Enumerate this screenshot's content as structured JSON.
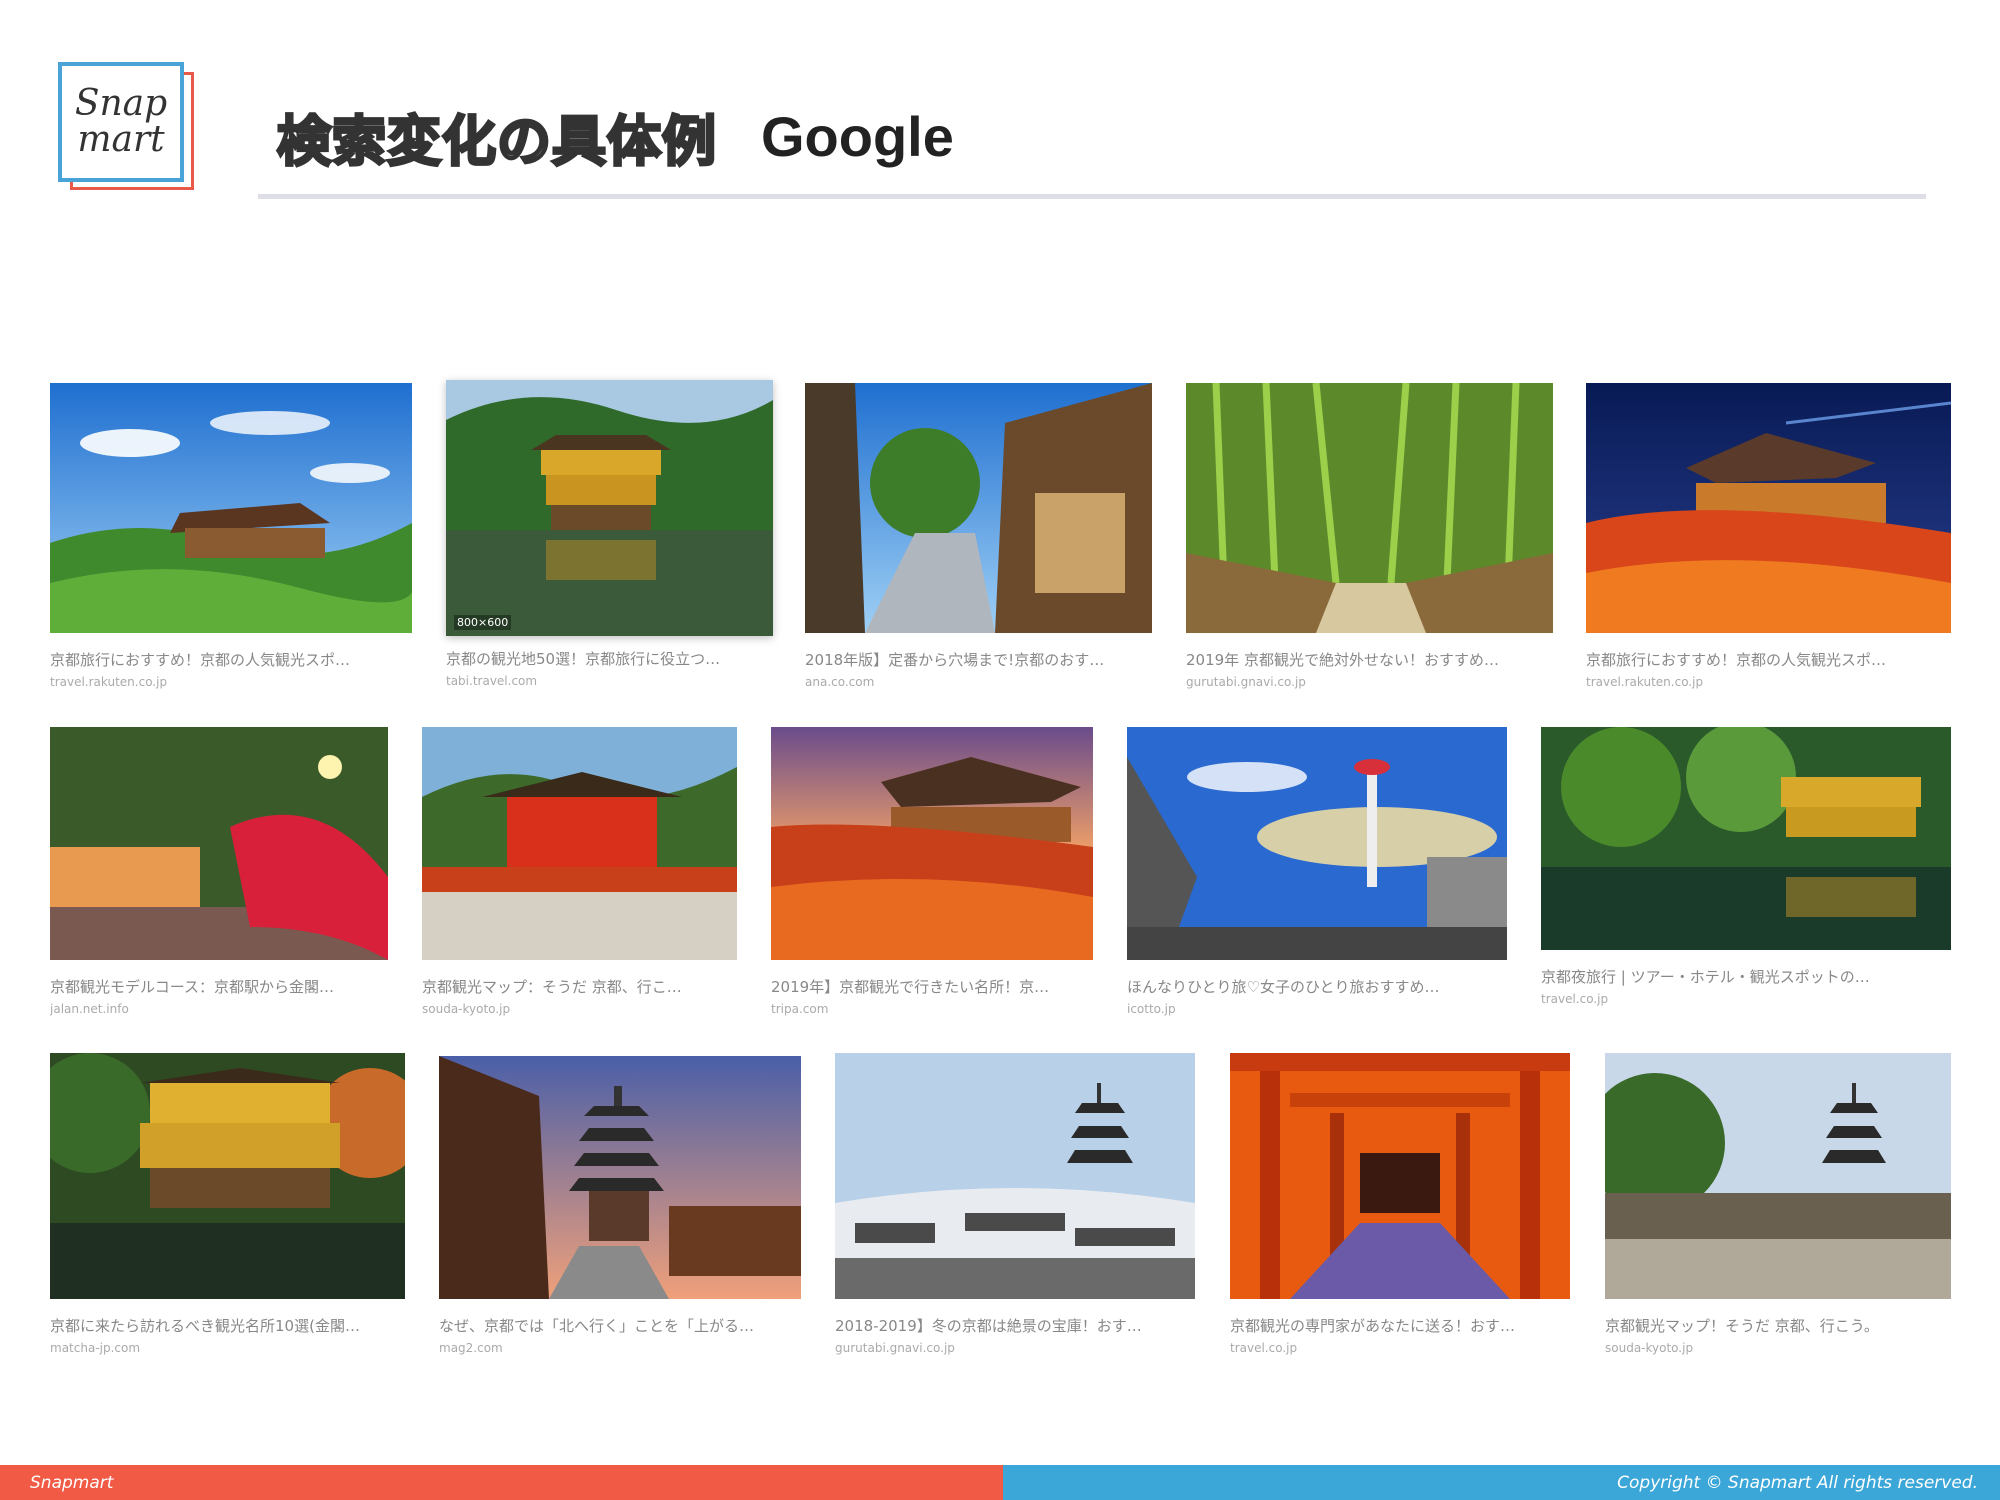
{
  "header": {
    "logo_line1": "Snap",
    "logo_line2": "mart",
    "title_jp": "検索変化の具体例",
    "title_en": "Google"
  },
  "results": {
    "row1": [
      {
        "caption": "京都旅行におすすめ！京都の人気観光スポ…",
        "source": "travel.rakuten.co.jp"
      },
      {
        "caption": "京都の観光地50選！京都旅行に役立つ…",
        "source": "tabi.travel.com",
        "dims": "800×600"
      },
      {
        "caption": "2018年版】定番から穴場まで!京都のおす…",
        "source": "ana.co.com"
      },
      {
        "caption": "2019年 京都観光で絶対外せない！おすすめ…",
        "source": "gurutabi.gnavi.co.jp"
      },
      {
        "caption": "京都旅行におすすめ！京都の人気観光スポ…",
        "source": "travel.rakuten.co.jp"
      }
    ],
    "row2": [
      {
        "caption": "京都観光モデルコース：京都駅から金閣…",
        "source": "jalan.net.info"
      },
      {
        "caption": "京都観光マップ：そうだ 京都、行こ…",
        "source": "souda-kyoto.jp"
      },
      {
        "caption": "2019年】京都観光で行きたい名所！京…",
        "source": "tripa.com"
      },
      {
        "caption": "ほんなりひとり旅♡女子のひとり旅おすすめ…",
        "source": "icotto.jp"
      },
      {
        "caption": "京都夜旅行 | ツアー・ホテル・観光スポットの…",
        "source": "travel.co.jp"
      }
    ],
    "row3": [
      {
        "caption": "京都に来たら訪れるべき観光名所10選(金閣…",
        "source": "matcha-jp.com"
      },
      {
        "caption": "なぜ、京都では「北へ行く」ことを「上がる…",
        "source": "mag2.com"
      },
      {
        "caption": "2018-2019】冬の京都は絶景の宝庫！おす…",
        "source": "gurutabi.gnavi.co.jp"
      },
      {
        "caption": "京都観光の専門家があなたに送る！おす…",
        "source": "travel.co.jp"
      },
      {
        "caption": "京都観光マップ！そうだ 京都、行こう。",
        "source": "souda-kyoto.jp"
      }
    ]
  },
  "footer": {
    "left_text": "Snapmart",
    "right_text": "Copyright © Snapmart All rights reserved."
  },
  "colors": {
    "footer_left": "#f15a45",
    "footer_right": "#3ba6d8",
    "logo_front_border": "#4aa3d6",
    "logo_back_border": "#e8594a"
  }
}
